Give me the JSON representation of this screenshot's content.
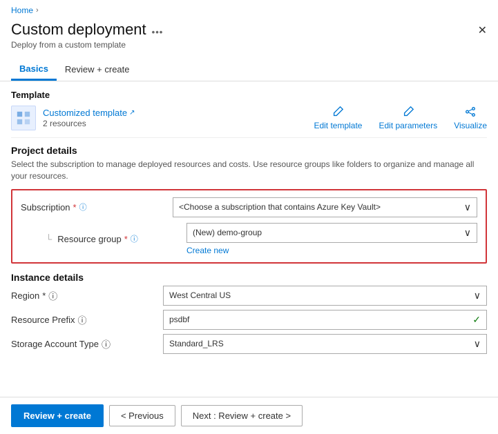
{
  "breadcrumb": {
    "home": "Home",
    "separator": "›"
  },
  "header": {
    "title": "Custom deployment",
    "subtitle": "Deploy from a custom template",
    "more_icon": "•••",
    "close_icon": "✕"
  },
  "tabs": [
    {
      "id": "basics",
      "label": "Basics",
      "active": true
    },
    {
      "id": "review-create",
      "label": "Review + create",
      "active": false
    }
  ],
  "template_section": {
    "label": "Template",
    "name": "Customized template",
    "external_icon": "↗",
    "resources": "2 resources",
    "actions": [
      {
        "id": "edit-template",
        "label": "Edit template",
        "icon": "pencil"
      },
      {
        "id": "edit-parameters",
        "label": "Edit parameters",
        "icon": "pencil"
      },
      {
        "id": "visualize",
        "label": "Visualize",
        "icon": "share"
      }
    ]
  },
  "project_details": {
    "title": "Project details",
    "description": "Select the subscription to manage deployed resources and costs. Use resource groups like folders to organize and manage all your resources.",
    "subscription_label": "Subscription",
    "subscription_required": "*",
    "subscription_value": "<Choose a subscription that contains Azure Key Vault>",
    "resource_group_label": "Resource group",
    "resource_group_required": "*",
    "resource_group_value": "(New) demo-group",
    "create_new_label": "Create new"
  },
  "instance_details": {
    "title": "Instance details",
    "region_label": "Region",
    "region_required": "*",
    "region_value": "West Central US",
    "resource_prefix_label": "Resource Prefix",
    "resource_prefix_value": "psdbf",
    "storage_account_type_label": "Storage Account Type",
    "storage_account_type_value": "Standard_LRS"
  },
  "bottom_bar": {
    "review_create_label": "Review + create",
    "previous_label": "< Previous",
    "next_label": "Next : Review + create >"
  }
}
